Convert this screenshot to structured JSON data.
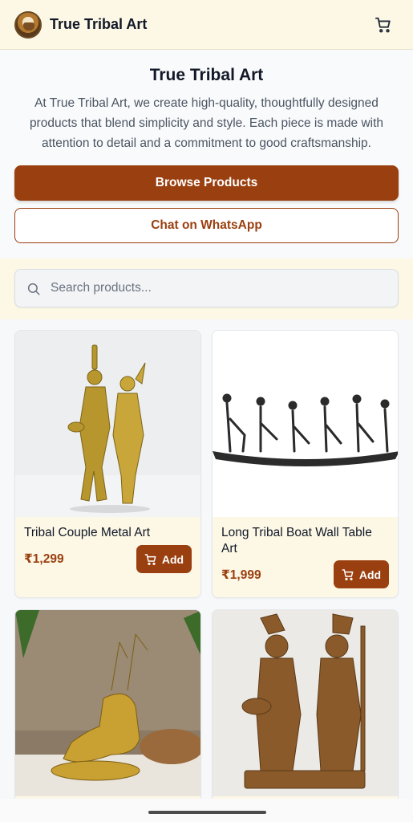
{
  "header": {
    "brand": "True Tribal Art",
    "cart_icon": "shopping-cart-icon"
  },
  "hero": {
    "title": "True Tribal Art",
    "description": "At True Tribal Art, we create high-quality, thoughtfully designed products that blend simplicity and style. Each piece is made with attention to detail and a commitment to good craftsmanship.",
    "browse_label": "Browse Products",
    "whatsapp_label": "Chat on WhatsApp"
  },
  "search": {
    "placeholder": "Search products...",
    "value": ""
  },
  "products": [
    {
      "name": "Tribal Couple Metal Art",
      "price": "₹1,299",
      "add_label": "Add"
    },
    {
      "name": "Long Tribal Boat Wall Table Art",
      "price": "₹1,999",
      "add_label": "Add"
    },
    {
      "name": "",
      "price": "",
      "add_label": ""
    },
    {
      "name": "",
      "price": "",
      "add_label": ""
    }
  ],
  "colors": {
    "accent": "#9a3f0f",
    "header_bg": "#fdf8e6",
    "page_bg": "#f7f8fa"
  }
}
